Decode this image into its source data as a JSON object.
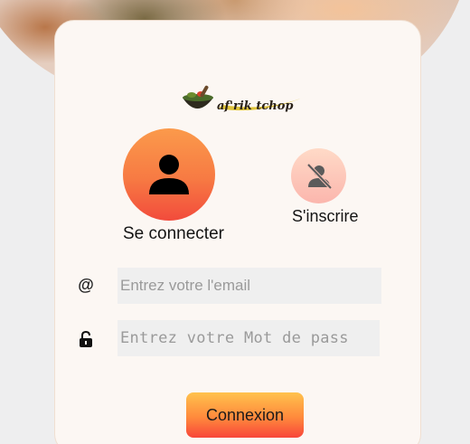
{
  "brand": {
    "logo_text": "af'rik tchop"
  },
  "auth_tabs": {
    "login_label": "Se connecter",
    "register_label": "S'inscrire"
  },
  "form": {
    "email_icon": "@",
    "email_placeholder": "Entrez votre l'email",
    "password_placeholder": "Entrez votre Mot de pass",
    "submit_label": "Connexion"
  },
  "colors": {
    "accent_orange": "#f77a43",
    "accent_red": "#f24b3c",
    "button_yellow": "#ffc24d",
    "card_bg": "#fcf7f3"
  },
  "icons": {
    "login": "person-icon",
    "register": "person-off-icon",
    "email": "at-icon",
    "password": "lock-open-icon",
    "logo": "mortar-pestle-icon"
  }
}
